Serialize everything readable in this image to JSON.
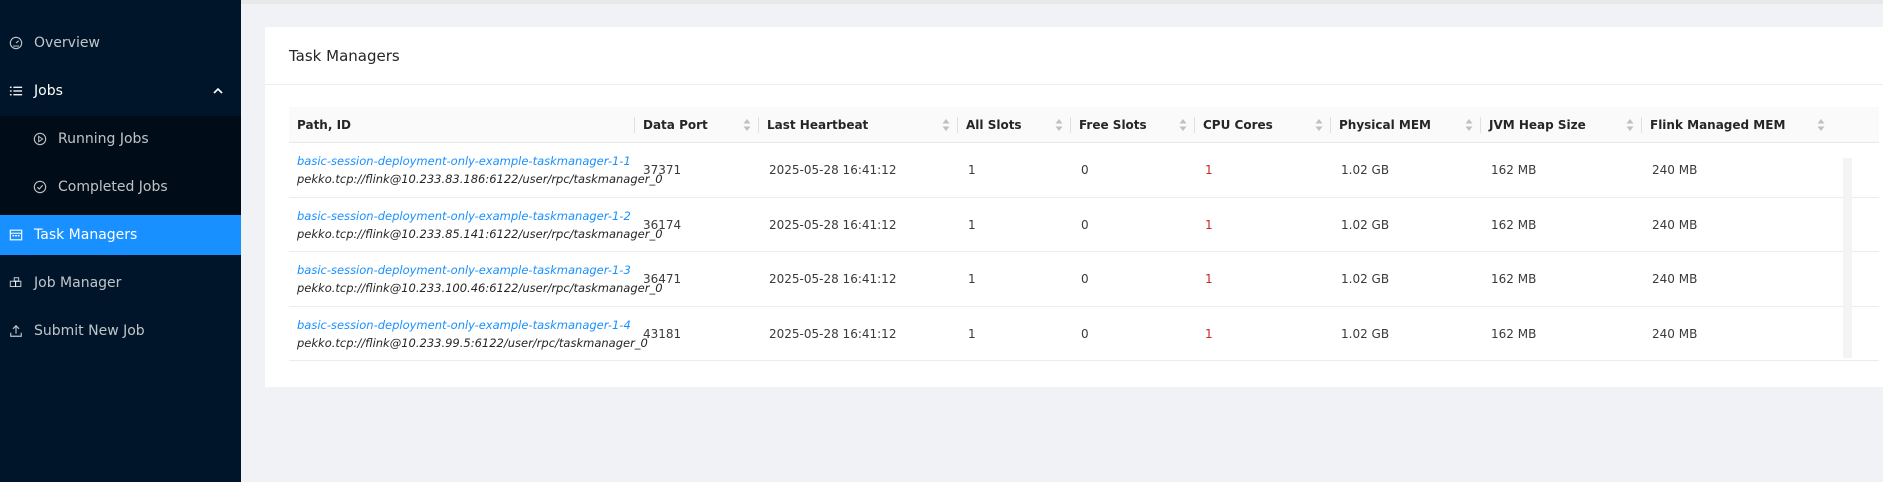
{
  "sidebar": {
    "items": [
      {
        "label": "Overview",
        "icon": "dashboard-icon"
      },
      {
        "label": "Jobs",
        "icon": "list-icon"
      },
      {
        "label": "Running Jobs",
        "icon": "play-circle-icon"
      },
      {
        "label": "Completed Jobs",
        "icon": "check-circle-icon"
      },
      {
        "label": "Task Managers",
        "icon": "schedule-icon",
        "active": true
      },
      {
        "label": "Job Manager",
        "icon": "build-icon"
      },
      {
        "label": "Submit New Job",
        "icon": "upload-icon"
      }
    ]
  },
  "card": {
    "title": "Task Managers"
  },
  "table": {
    "columns": [
      "Path, ID",
      "Data Port",
      "Last Heartbeat",
      "All Slots",
      "Free Slots",
      "CPU Cores",
      "Physical MEM",
      "JVM Heap Size",
      "Flink Managed MEM"
    ],
    "rows": [
      {
        "id": "basic-session-deployment-only-example-taskmanager-1-1",
        "path": "pekko.tcp://flink@10.233.83.186:6122/user/rpc/taskmanager_0",
        "data_port": "37371",
        "heartbeat": "2025-05-28 16:41:12",
        "all_slots": "1",
        "free_slots": "0",
        "cpu_cores": "1",
        "physical_mem": "1.02 GB",
        "jvm_heap": "162 MB",
        "managed_mem": "240 MB"
      },
      {
        "id": "basic-session-deployment-only-example-taskmanager-1-2",
        "path": "pekko.tcp://flink@10.233.85.141:6122/user/rpc/taskmanager_0",
        "data_port": "36174",
        "heartbeat": "2025-05-28 16:41:12",
        "all_slots": "1",
        "free_slots": "0",
        "cpu_cores": "1",
        "physical_mem": "1.02 GB",
        "jvm_heap": "162 MB",
        "managed_mem": "240 MB"
      },
      {
        "id": "basic-session-deployment-only-example-taskmanager-1-3",
        "path": "pekko.tcp://flink@10.233.100.46:6122/user/rpc/taskmanager_0",
        "data_port": "36471",
        "heartbeat": "2025-05-28 16:41:12",
        "all_slots": "1",
        "free_slots": "0",
        "cpu_cores": "1",
        "physical_mem": "1.02 GB",
        "jvm_heap": "162 MB",
        "managed_mem": "240 MB"
      },
      {
        "id": "basic-session-deployment-only-example-taskmanager-1-4",
        "path": "pekko.tcp://flink@10.233.99.5:6122/user/rpc/taskmanager_0",
        "data_port": "43181",
        "heartbeat": "2025-05-28 16:41:12",
        "all_slots": "1",
        "free_slots": "0",
        "cpu_cores": "1",
        "physical_mem": "1.02 GB",
        "jvm_heap": "162 MB",
        "managed_mem": "240 MB"
      }
    ]
  },
  "colors": {
    "sidebar_bg": "#001529",
    "submenu_bg": "#000c17",
    "accent": "#1890ff",
    "cpu_text": "#c62828"
  }
}
